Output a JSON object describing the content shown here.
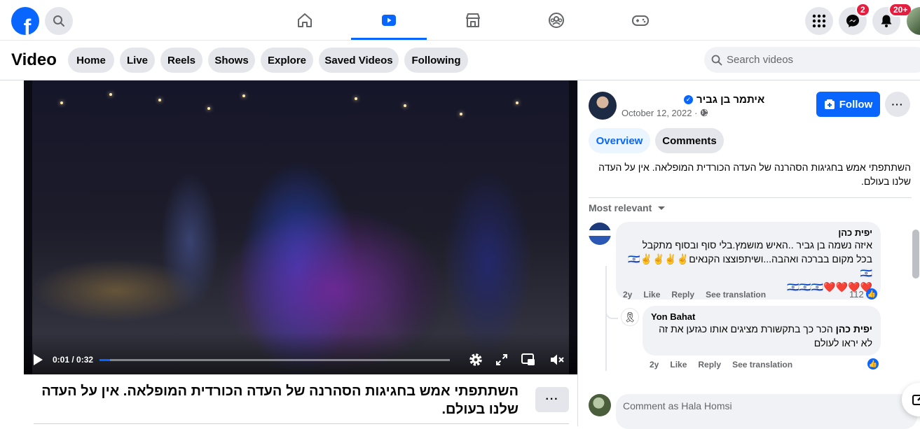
{
  "topbar": {
    "logo": "f",
    "messenger_badge": "2",
    "notifications_badge": "20+"
  },
  "video_section": {
    "title": "Video",
    "nav_pills": [
      "Home",
      "Live",
      "Reels",
      "Shows",
      "Explore",
      "Saved Videos",
      "Following"
    ],
    "search_placeholder": "Search videos"
  },
  "player": {
    "time": "0:01 / 0:32",
    "progress_fraction": 0.03
  },
  "post": {
    "caption": "השתתפתי אמש בחגיגות הסהרנה של העדה הכורדית המופלאה. אין על העדה שלנו בעולם.",
    "author": "איתמר בן גביר",
    "date": "October 12, 2022 · ",
    "follow_label": "Follow",
    "tabs": [
      "Overview",
      "Comments"
    ],
    "description": "השתתפתי אמש בחגיגות הסהרנה של העדה הכורדית המופלאה. אין על העדה שלנו בעולם.",
    "sort_label": "Most relevant"
  },
  "comments": [
    {
      "name": "יפית כהן",
      "text": "איזה נשמה בן גביר ..האיש מושמץ.בלי סוף ובסוף מתקבל בכל מקום בברכה ואהבה...ושיתפוצצו הקנאים✌️✌️✌️✌️🇮🇱🇮🇱",
      "emoji_line": "❤️❤️❤️❤️🇮🇱🇮🇱🇮🇱",
      "age": "2y",
      "like": "Like",
      "reply": "Reply",
      "translate": "See translation",
      "likes": "112"
    },
    {
      "name": "Yon Bahat",
      "mention": "יפית כהן",
      "text": "הכר כך בתקשורת מציגים אותו כגזען את זה לא יראו לעולם",
      "age": "2y",
      "like": "Like",
      "reply": "Reply",
      "translate": "See translation"
    }
  ],
  "comment_box": {
    "placeholder": "Comment as Hala Homsi"
  },
  "colors": {
    "brand_blue": "#0866ff",
    "badge_red": "#e41e3f",
    "pill_gray": "#e4e6eb"
  }
}
